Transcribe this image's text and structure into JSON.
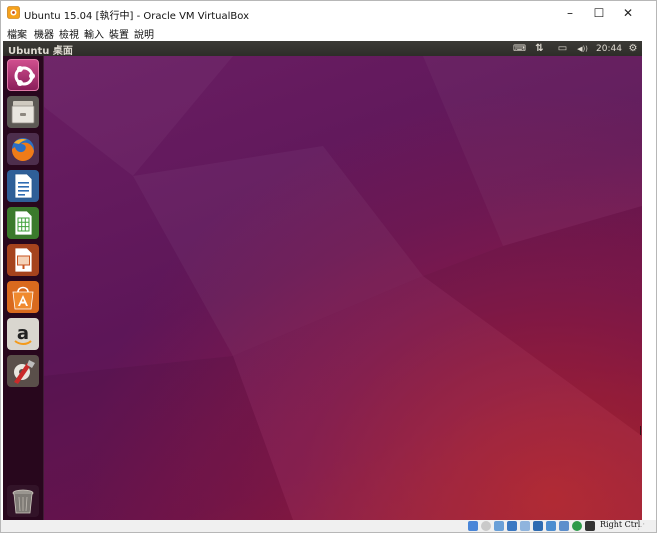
{
  "window": {
    "title": "Ubuntu 15.04 [執行中] - Oracle VM VirtualBox",
    "buttons": {
      "minimize": "–",
      "maximize": "☐",
      "close": "✕"
    }
  },
  "menubar": {
    "items": [
      "檔案",
      "機器",
      "檢視",
      "輸入",
      "裝置",
      "說明"
    ]
  },
  "guest": {
    "topbar_label": "Ubuntu 桌面",
    "tray": {
      "keyboard": "⌨",
      "network": "⇅",
      "battery": "▭",
      "volume": "◀))",
      "clock": "20:44",
      "settings": "⚙"
    },
    "launcher": [
      {
        "name": "ubuntu-dash-icon"
      },
      {
        "name": "files-icon"
      },
      {
        "name": "firefox-icon"
      },
      {
        "name": "writer-icon"
      },
      {
        "name": "calc-icon"
      },
      {
        "name": "impress-icon"
      },
      {
        "name": "software-center-icon"
      },
      {
        "name": "amazon-icon"
      },
      {
        "name": "system-settings-icon"
      },
      {
        "name": "trash-icon"
      }
    ],
    "amazon_letter": "a"
  },
  "statusbar": {
    "host_key": "Right Ctrl"
  },
  "colors": {
    "ubuntu_orange": "#e95420",
    "launcher_bg": "#28081e"
  }
}
